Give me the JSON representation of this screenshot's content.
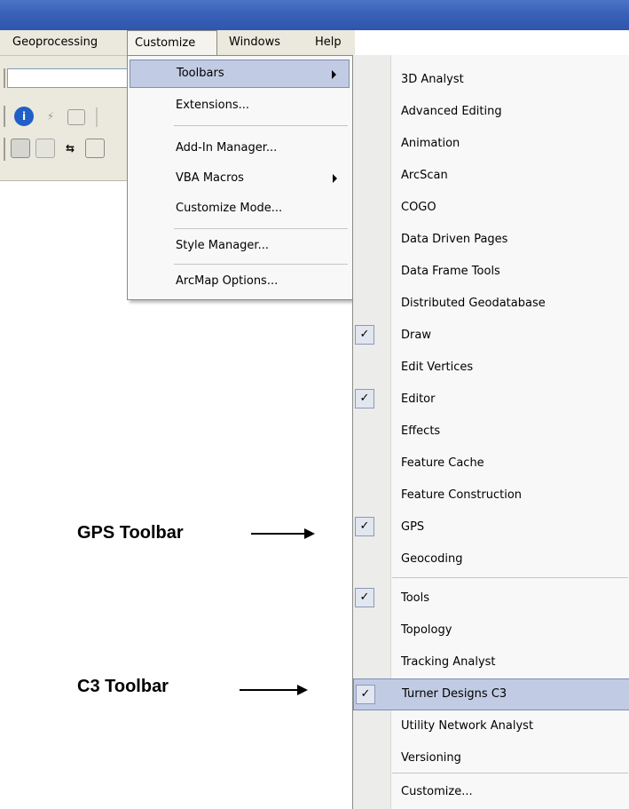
{
  "menubar": {
    "items": [
      "Geoprocessing",
      "Customize",
      "Windows",
      "Help"
    ]
  },
  "customize_menu": {
    "items": [
      {
        "label": "Toolbars",
        "submenu": true,
        "highlighted": true
      },
      {
        "label": "Extensions..."
      },
      {
        "label": "Add-In Manager..."
      },
      {
        "label": "VBA Macros",
        "submenu": true
      },
      {
        "label": "Customize Mode..."
      },
      {
        "label": "Style Manager..."
      },
      {
        "label": "ArcMap Options..."
      }
    ]
  },
  "toolbars_submenu": {
    "items": [
      {
        "label": "3D Analyst",
        "checked": false
      },
      {
        "label": "Advanced Editing",
        "checked": false
      },
      {
        "label": "Animation",
        "checked": false
      },
      {
        "label": "ArcScan",
        "checked": false
      },
      {
        "label": "COGO",
        "checked": false
      },
      {
        "label": "Data Driven Pages",
        "checked": false
      },
      {
        "label": "Data Frame Tools",
        "checked": false
      },
      {
        "label": "Distributed Geodatabase",
        "checked": false
      },
      {
        "label": "Draw",
        "checked": true
      },
      {
        "label": "Edit Vertices",
        "checked": false
      },
      {
        "label": "Editor",
        "checked": true
      },
      {
        "label": "Effects",
        "checked": false
      },
      {
        "label": "Feature Cache",
        "checked": false
      },
      {
        "label": "Feature Construction",
        "checked": false
      },
      {
        "label": "GPS",
        "checked": true
      },
      {
        "label": "Geocoding",
        "checked": false
      },
      {
        "label": "Tools",
        "checked": true
      },
      {
        "label": "Topology",
        "checked": false
      },
      {
        "label": "Tracking Analyst",
        "checked": false
      },
      {
        "label": "Turner Designs C3",
        "checked": true,
        "highlighted": true
      },
      {
        "label": "Utility Network Analyst",
        "checked": false
      },
      {
        "label": "Versioning",
        "checked": false
      },
      {
        "label": "Customize...",
        "checked": false
      }
    ],
    "check_glyph": "✓"
  },
  "annotations": {
    "gps": "GPS Toolbar",
    "c3": "C3 Toolbar"
  },
  "colors": {
    "titlebar": "#3a61b8",
    "menu_highlight": "#c1cbe3",
    "menu_bg": "#f8f8f8",
    "toolbar_bg": "#ebe9dd"
  }
}
